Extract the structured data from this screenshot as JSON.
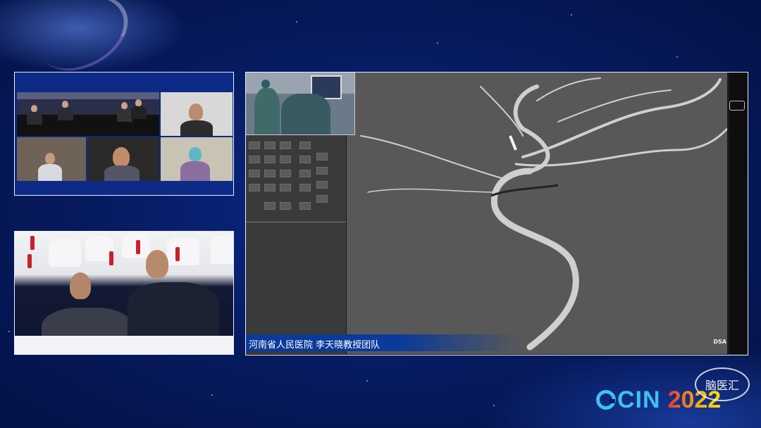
{
  "video_panels": {
    "conference_grid": {
      "tiles": [
        {
          "name": "meeting-room",
          "label": ""
        },
        {
          "name": "remote-1",
          "label": ""
        },
        {
          "name": "remote-2",
          "label": ""
        },
        {
          "name": "remote-3",
          "label": ""
        },
        {
          "name": "remote-4",
          "label": ""
        }
      ]
    },
    "audience_feed": {},
    "main_feed": {
      "caption": "河南省人民医院  李天晓教授团队",
      "overlay_label": "DSA"
    }
  },
  "branding": {
    "event_logo_text": "CIN",
    "event_year": "2022",
    "seal_text": "脑医汇",
    "accent_color": "#3fc0f0",
    "background_color": "#061a5e"
  }
}
